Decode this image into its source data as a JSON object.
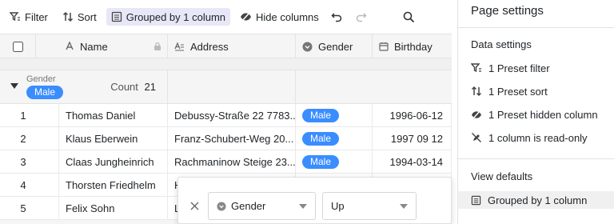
{
  "toolbar": {
    "filter_label": "Filter",
    "sort_label": "Sort",
    "group_label": "Grouped by 1 column",
    "hide_label": "Hide columns"
  },
  "columns": {
    "name": "Name",
    "address": "Address",
    "gender": "Gender",
    "birthday": "Birthday"
  },
  "group": {
    "field": "Gender",
    "value": "Male",
    "count_label": "Count",
    "count": "21"
  },
  "rows": [
    {
      "index": "1",
      "name": "Thomas Daniel",
      "address": "Debussy-Straße 22 7783...",
      "gender": "Male",
      "birthday": "1996-06-12"
    },
    {
      "index": "2",
      "name": "Klaus Eberwein",
      "address": "Franz-Schubert-Weg 20...",
      "gender": "Male",
      "birthday": "1997 09 12"
    },
    {
      "index": "3",
      "name": "Claas Jungheinrich",
      "address": "Rachmaninow Steige 23...",
      "gender": "Male",
      "birthday": "1994-03-14"
    },
    {
      "index": "4",
      "name": "Thorsten Friedhelm",
      "address": "H",
      "gender": "",
      "birthday": ""
    },
    {
      "index": "5",
      "name": "Felix Sohn",
      "address": "L",
      "gender": "",
      "birthday": ""
    }
  ],
  "sort_popup": {
    "field": "Gender",
    "direction": "Up"
  },
  "panel": {
    "title": "Page settings",
    "data_settings_title": "Data settings",
    "items": [
      "1 Preset filter",
      "1 Preset sort",
      "1 Preset hidden column",
      "1 column is read-only"
    ],
    "view_defaults_title": "View defaults",
    "view_item": "Grouped by 1 column"
  },
  "colors": {
    "accent": "#3a8dff",
    "active_bg": "#e7e7f7"
  }
}
